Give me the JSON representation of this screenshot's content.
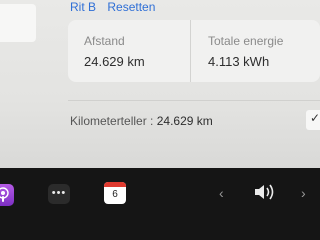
{
  "tabs": [
    "Rit B",
    "Resetten"
  ],
  "stats": {
    "distance_label": "Afstand",
    "distance_value": "24.629 km",
    "energy_label": "Totale energie",
    "energy_value": "4.113 kWh"
  },
  "odometer": {
    "label": "Kilometerteller :",
    "value": "24.629 km"
  },
  "taskbar": {
    "more_label": "•••",
    "calendar_day": "6",
    "prev_glyph": "‹",
    "next_glyph": "›"
  },
  "colors": {
    "tab_link": "#2f6fd6",
    "calendar_red": "#e03a2f",
    "podcasts_purple": "#9b45d8"
  },
  "icons": [
    "podcasts-icon",
    "more-icon",
    "calendar-icon",
    "chevron-left-icon",
    "volume-icon",
    "chevron-right-icon",
    "check-icon"
  ]
}
